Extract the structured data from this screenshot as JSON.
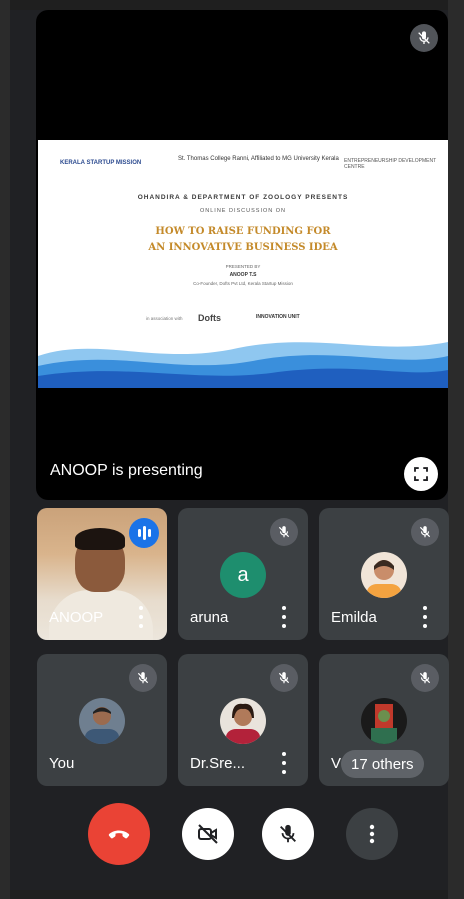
{
  "presentation": {
    "label": "ANOOP is presenting",
    "slide": {
      "logo_left": "KERALA STARTUP MISSION",
      "logo_center": "St. Thomas College Ranni, Affiliated to MG University Kerala",
      "logo_right": "ENTREPRENEURSHIP DEVELOPMENT CENTRE",
      "presents": "OHANDIRA & DEPARTMENT OF ZOOLOGY PRESENTS",
      "subtitle": "ONLINE DISCUSSION ON",
      "title_line1": "HOW TO RAISE FUNDING FOR",
      "title_line2": "AN INNOVATIVE BUSINESS IDEA",
      "presented_by": "PRESENTED BY",
      "speaker": "ANOOP T.S",
      "speaker_role": "Co-Founder, Dofts Pvt Ltd, Kerala Startup Mission",
      "sponsor_prefix": "in association with",
      "sponsor1": "Dofts",
      "sponsor2": "INNOVATION UNIT"
    }
  },
  "participants": [
    {
      "name": "ANOOP",
      "type": "video",
      "speaking": true
    },
    {
      "name": "aruna",
      "type": "letter",
      "letter": "a",
      "muted": true
    },
    {
      "name": "Emilda",
      "type": "photo",
      "muted": true
    },
    {
      "name": "You",
      "type": "photo",
      "muted": true
    },
    {
      "name": "Dr.Sre...",
      "type": "photo",
      "muted": true
    },
    {
      "name": "V",
      "type": "photo",
      "muted": true
    }
  ],
  "others_count": "17 others",
  "controls": {
    "end_call": "end-call",
    "camera": "camera-off",
    "mic": "mic-off",
    "more": "more-options"
  },
  "colors": {
    "background": "#202124",
    "tile": "#3c4043",
    "end_call": "#ea4335",
    "speaking": "#1a73e8",
    "letter_avatar": "#1e8e6e"
  }
}
